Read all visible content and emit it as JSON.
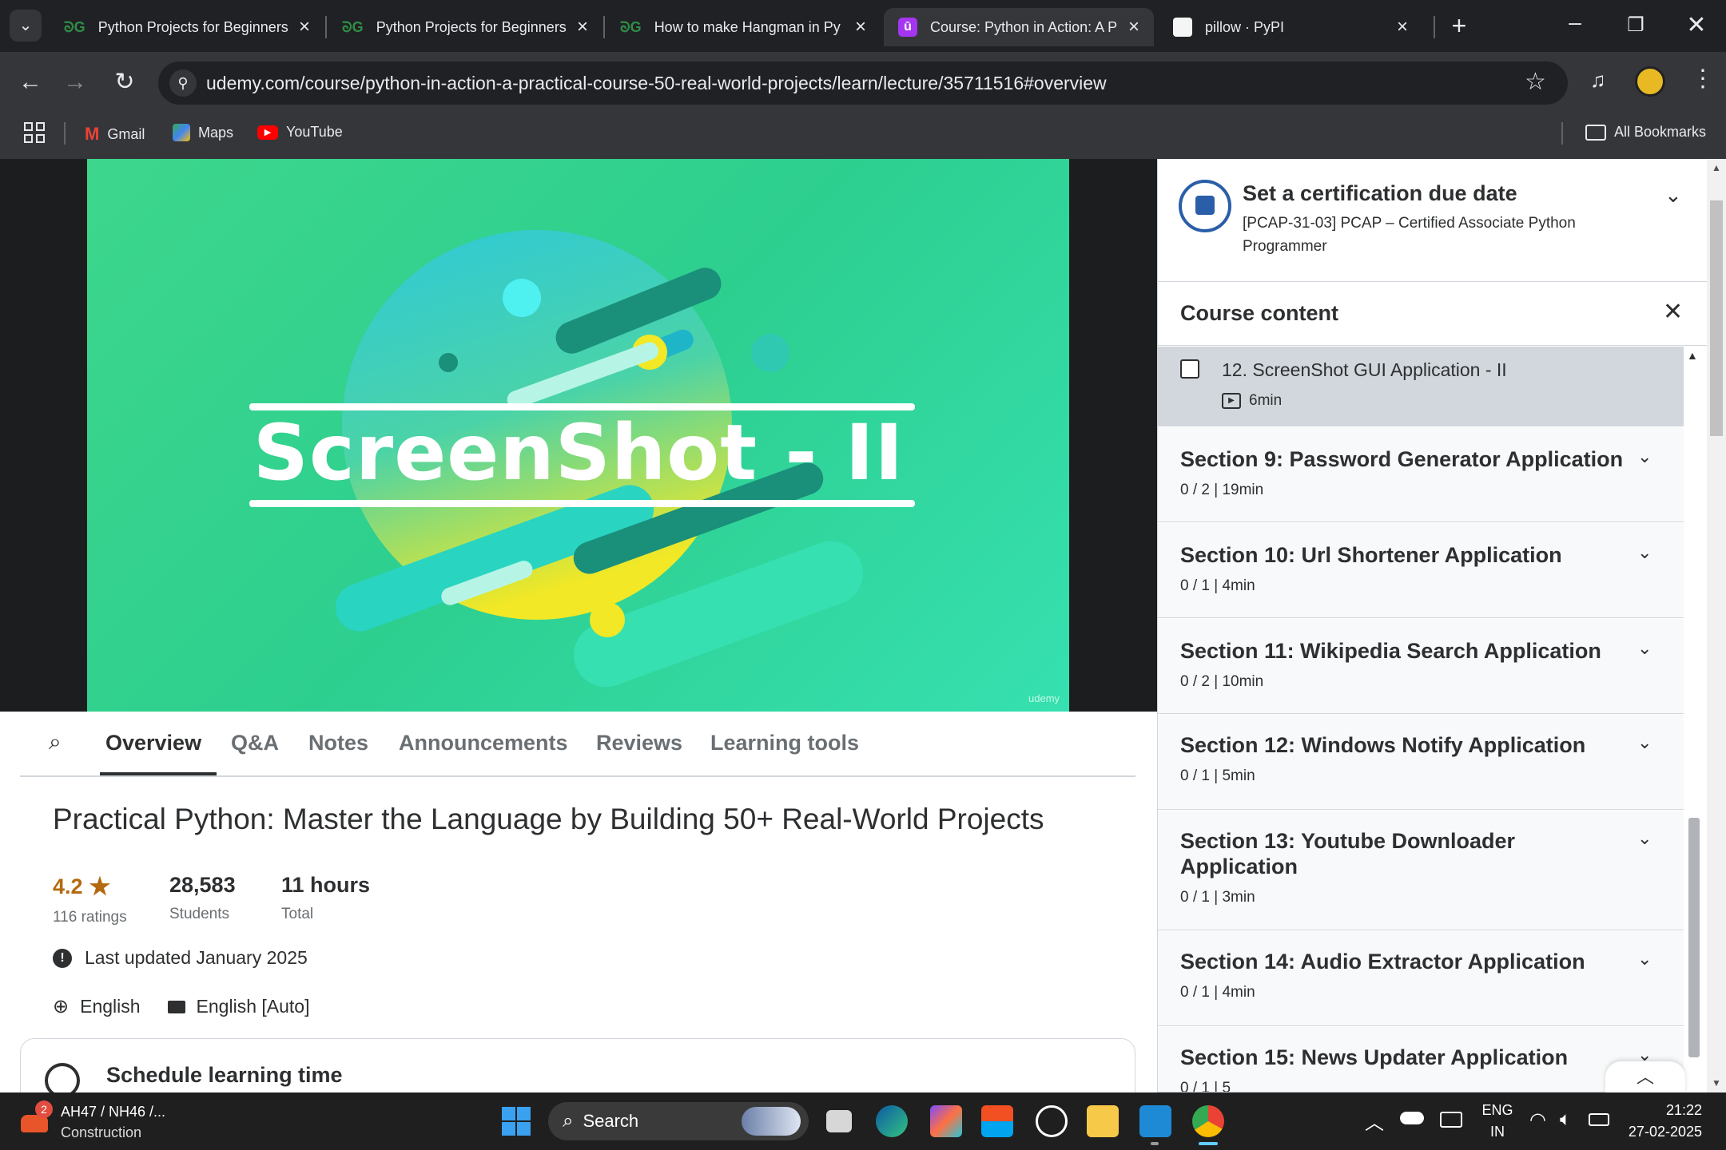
{
  "browser": {
    "tabs": [
      {
        "title": "Python Projects for Beginners",
        "active": false
      },
      {
        "title": "Python Projects for Beginners",
        "active": false
      },
      {
        "title": "How to make Hangman in Py",
        "active": false
      },
      {
        "title": "Course: Python in Action: A P",
        "active": true
      },
      {
        "title": "pillow · PyPI",
        "active": false
      }
    ],
    "url": "udemy.com/course/python-in-action-a-practical-course-50-real-world-projects/learn/lecture/35711516#overview",
    "bookmarks": [
      "Gmail",
      "Maps",
      "YouTube"
    ],
    "all_bookmarks": "All Bookmarks"
  },
  "video": {
    "title": "ScreenShot - II",
    "watermark": "udemy"
  },
  "nav_tabs": [
    "Overview",
    "Q&A",
    "Notes",
    "Announcements",
    "Reviews",
    "Learning tools"
  ],
  "course": {
    "title": "Practical Python: Master the Language by Building 50+ Real-World Projects",
    "rating": "4.2",
    "ratings_label": "116 ratings",
    "students": "28,583",
    "students_label": "Students",
    "hours": "11 hours",
    "hours_label": "Total",
    "updated": "Last updated January 2025",
    "language": "English",
    "captions": "English [Auto]",
    "schedule": "Schedule learning time"
  },
  "sidebar": {
    "cert_title": "Set a certification due date",
    "cert_sub": "[PCAP-31-03] PCAP – Certified Associate Python Programmer",
    "content_title": "Course content",
    "lecture": {
      "title": "12. ScreenShot GUI Application - II",
      "duration": "6min"
    },
    "sections": [
      {
        "title": "Section 9: Password Generator Application",
        "meta": "0 / 2 | 19min"
      },
      {
        "title": "Section 10: Url Shortener Application",
        "meta": "0 / 1 | 4min"
      },
      {
        "title": "Section 11: Wikipedia Search Application",
        "meta": "0 / 2 | 10min"
      },
      {
        "title": "Section 12: Windows Notify Application",
        "meta": "0 / 1 | 5min"
      },
      {
        "title": "Section 13: Youtube Downloader Application",
        "meta": "0 / 1 | 3min"
      },
      {
        "title": "Section 14: Audio Extractor Application",
        "meta": "0 / 1 | 4min"
      },
      {
        "title": "Section 15: News Updater Application",
        "meta": "0 / 1 | 5"
      }
    ]
  },
  "taskbar": {
    "news_title": "AH47 / NH46 /...",
    "news_sub": "Construction",
    "news_badge": "2",
    "search": "Search",
    "lang1": "ENG",
    "lang2": "IN",
    "time": "21:22",
    "date": "27-02-2025"
  }
}
